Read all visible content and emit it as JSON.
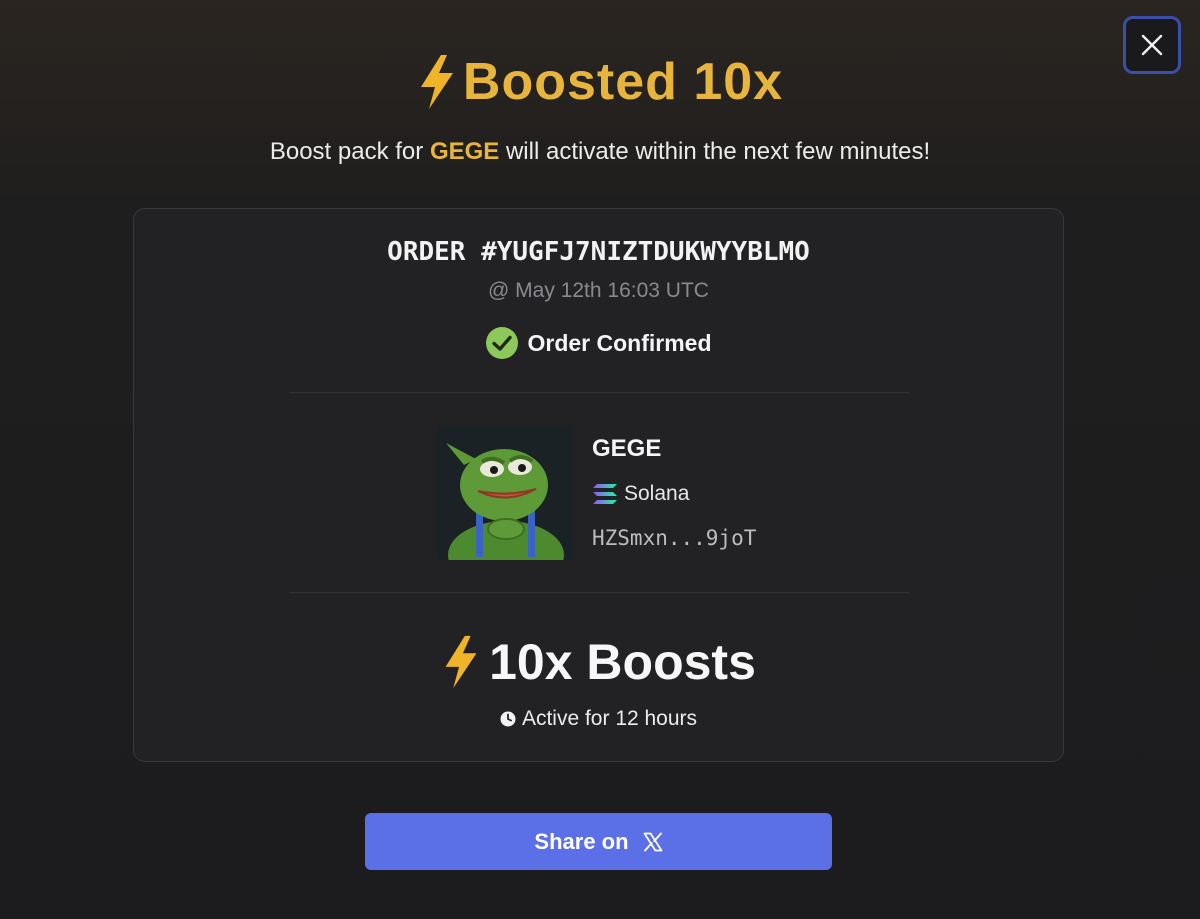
{
  "modal": {
    "close_icon": "close-icon",
    "headline_icon": "lightning-bolt-icon",
    "headline": "Boosted 10x",
    "subline_before": "Boost pack for",
    "subline_token": "GEGE",
    "subline_after": "will activate within the next few minutes!",
    "accent_color": "#e8b53c"
  },
  "order": {
    "id_label": "ORDER #YUGFJ7NIZTDUKWYYBLMO",
    "timestamp": "@ May 12th 16:03 UTC",
    "status_icon": "check-circle-icon",
    "status": "Order Confirmed",
    "status_color": "#8dc85a"
  },
  "token": {
    "image_icon": "pepe-token-avatar",
    "name": "GEGE",
    "chain_icon": "solana-icon",
    "chain": "Solana",
    "address": "HZSmxn...9joT"
  },
  "boosts": {
    "icon": "lightning-bolt-icon",
    "label": "10x Boosts",
    "duration_icon": "clock-icon",
    "duration": "Active for 12 hours"
  },
  "share": {
    "label": "Share on",
    "icon": "x-logo-icon",
    "color": "#5b6fe6"
  }
}
